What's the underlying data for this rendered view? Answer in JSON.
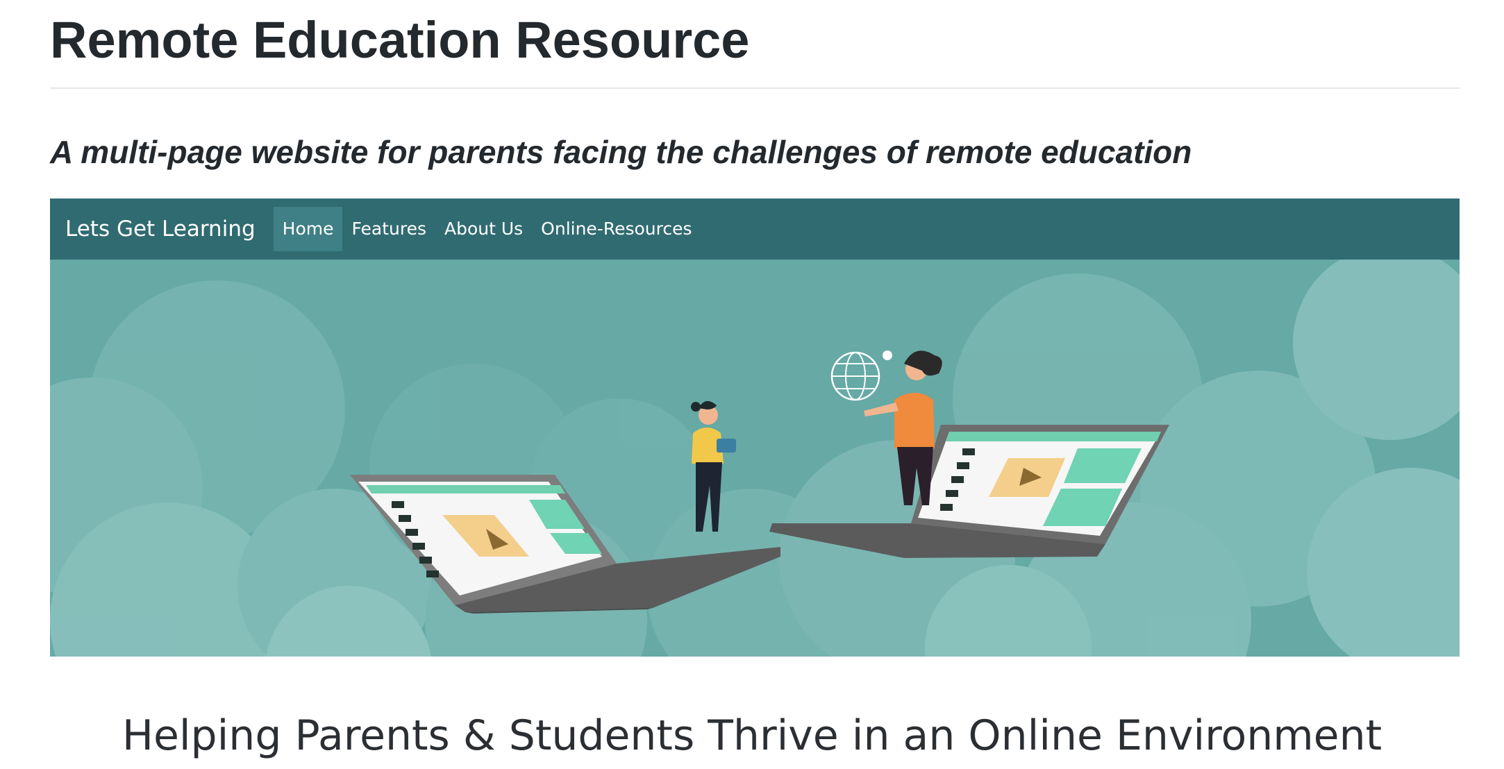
{
  "page": {
    "title": "Remote Education Resource",
    "subtitle": "A multi-page website for parents facing the challenges of remote education"
  },
  "navbar": {
    "brand": "Lets Get Learning",
    "links": [
      {
        "label": "Home",
        "active": true
      },
      {
        "label": "Features",
        "active": false
      },
      {
        "label": "About Us",
        "active": false
      },
      {
        "label": "Online-Resources",
        "active": false
      }
    ]
  },
  "hero": {
    "tagline": "Helping Parents & Students Thrive in an Online Environment"
  },
  "colors": {
    "navbar_bg": "#316b72",
    "nav_active_bg": "#3f7f86",
    "hero_bg": "#66a9a5",
    "cloud_light": "#8cc3bf",
    "laptop_gray": "#6a6a6a",
    "screen_teal": "#6fd3b4",
    "play_tile": "#f3cf8b",
    "shirt_yellow": "#f2c84b",
    "shirt_orange": "#f08a3c"
  }
}
